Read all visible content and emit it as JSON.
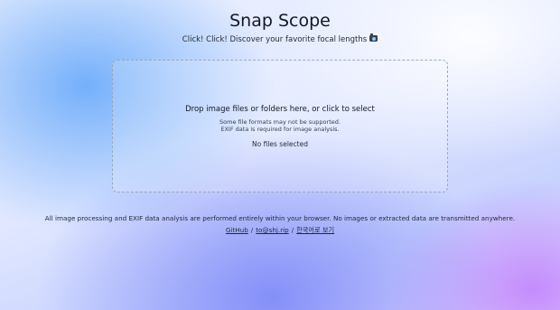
{
  "header": {
    "title": "Snap Scope",
    "subtitle": "Click! Click! Discover your favorite focal lengths",
    "subtitle_icon": "camera-icon"
  },
  "dropzone": {
    "main_label": "Drop image files or folders here, or click to select",
    "note_line1": "Some file formats may not be supported.",
    "note_line2": "EXIF data is required for image analysis.",
    "status": "No files selected"
  },
  "footer": {
    "privacy_text": "All image processing and EXIF data analysis are performed entirely within your browser. No images or extracted data are transmitted anywhere.",
    "links": {
      "github": "GitHub",
      "email": "to@shj.rip",
      "korean": "한국어로 보기",
      "separator": "/"
    }
  },
  "colors": {
    "gradient_blue": "#60a5fa",
    "gradient_indigo": "#818cf8",
    "gradient_purple": "#c084fc",
    "text": "#1f2937"
  }
}
